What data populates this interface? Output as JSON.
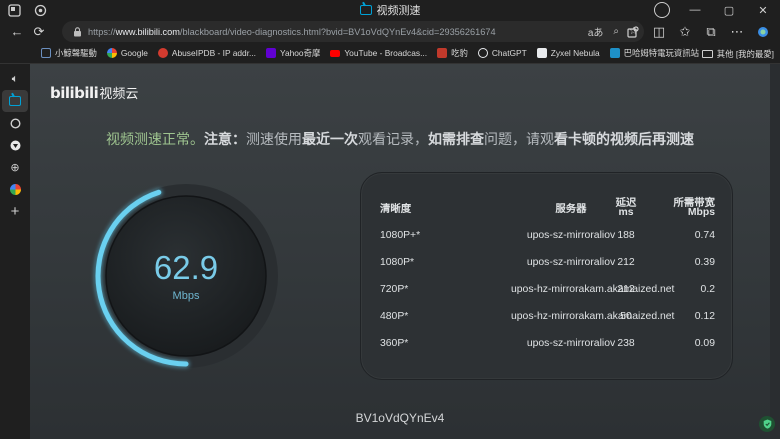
{
  "window": {
    "title": "视频测速",
    "title_icon": "bilibili-tv-icon"
  },
  "addressbar": {
    "url_prefix": "https://",
    "url_host": "www.bilibili.com",
    "url_rest": "/blackboard/video-diagnostics.html?bvid=BV1oVdQYnEv4&cid=29356261674"
  },
  "bookmarks": {
    "items": [
      {
        "label": "小鯨聲驅動",
        "color": "#6b8fbf"
      },
      {
        "label": "Google",
        "color": "#e8eaed"
      },
      {
        "label": "AbuseIPDB - IP addr...",
        "color": "#d33b2f"
      },
      {
        "label": "Yahoo奇摩",
        "color": "#6001d2"
      },
      {
        "label": "YouTube - Broadcas...",
        "color": "#ff0000"
      },
      {
        "label": "吃豹",
        "color": "#c0392b"
      },
      {
        "label": "ChatGPT",
        "color": "#e8eaed"
      },
      {
        "label": "Zyxel Nebula",
        "color": "#e8eaed"
      },
      {
        "label": "巴哈姆特電玩資訊站",
        "color": "#1e90c8"
      }
    ],
    "other_folder": "其他 [我的最愛]"
  },
  "page": {
    "logo_text": "bilibili",
    "logo_suffix": "视频云",
    "notice": {
      "status": "视频测速正常。",
      "label": "注意：",
      "part1": "测速使用",
      "bold1": "最近一次",
      "part2": "观看记录，",
      "bold2": "如需排查",
      "part3": "问题，请观",
      "bold3": "看卡顿",
      "bold4": "的视频后再测速"
    },
    "gauge": {
      "value": "62.9",
      "unit": "Mbps",
      "fill_fraction": 0.45,
      "accent": "#6ad0f0"
    },
    "table": {
      "headers": {
        "quality": "清晰度",
        "server": "服务器",
        "latency_top": "延迟",
        "latency_bottom": "ms",
        "bandwidth_top": "所需带宽",
        "bandwidth_bottom": "Mbps"
      },
      "rows": [
        {
          "quality": "1080P+*",
          "server": "upos-sz-mirroraliov",
          "latency": "188",
          "bandwidth": "0.74"
        },
        {
          "quality": "1080P*",
          "server": "upos-sz-mirroraliov",
          "latency": "212",
          "bandwidth": "0.39"
        },
        {
          "quality": "720P*",
          "server": "upos-hz-mirrorakam.akamaized.net",
          "latency": "212",
          "bandwidth": "0.2"
        },
        {
          "quality": "480P*",
          "server": "upos-hz-mirrorakam.akamaized.net",
          "latency": "50",
          "bandwidth": "0.12"
        },
        {
          "quality": "360P*",
          "server": "upos-sz-mirroraliov",
          "latency": "238",
          "bandwidth": "0.09"
        }
      ]
    },
    "bvid": "BV1oVdQYnEv4"
  }
}
